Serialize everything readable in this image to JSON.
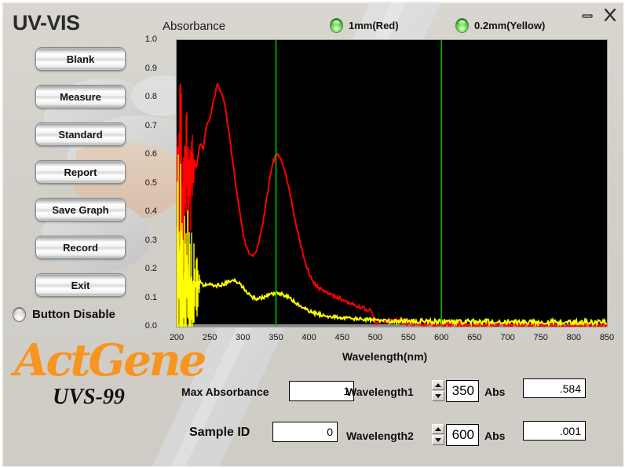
{
  "window": {
    "title": "UV-VIS",
    "minimize_icon": "minimize-icon",
    "close_icon": "close-icon"
  },
  "chart_header": {
    "title": "Absorbance",
    "legend": [
      {
        "label": "1mm(Red)",
        "led": "green-led",
        "color": "#ff0000"
      },
      {
        "label": "0.2mm(Yellow)",
        "led": "green-led",
        "color": "#ffff00"
      }
    ]
  },
  "sidebar": {
    "buttons": [
      {
        "label": "Blank"
      },
      {
        "label": "Measure"
      },
      {
        "label": "Standard"
      },
      {
        "label": "Report"
      },
      {
        "label": "Save Graph"
      },
      {
        "label": "Record"
      },
      {
        "label": "Exit"
      }
    ],
    "button_disable": {
      "label": "Button Disable",
      "led": "gray-led",
      "state": "off"
    }
  },
  "brand": {
    "name": "ActGene",
    "model": "UVS-99",
    "color": "#f79520"
  },
  "controls": {
    "max_absorbance": {
      "label": "Max Absorbance",
      "value": "1"
    },
    "sample_id": {
      "label": "Sample ID",
      "value": "0"
    },
    "wavelength1": {
      "label": "Wavelength1",
      "value": "350",
      "abs_label": "Abs",
      "abs_value": ".584"
    },
    "wavelength2": {
      "label": "Wavelength2",
      "value": "600",
      "abs_label": "Abs",
      "abs_value": ".001"
    }
  },
  "chart_data": {
    "type": "line",
    "title": "Absorbance",
    "xlabel": "Wavelength(nm)",
    "ylabel": "Absorbance",
    "xlim": [
      200,
      850
    ],
    "ylim": [
      0.0,
      1.0
    ],
    "xticks": [
      200,
      250,
      300,
      350,
      400,
      450,
      500,
      550,
      600,
      650,
      700,
      750,
      800,
      850
    ],
    "yticks": [
      0.0,
      0.1,
      0.2,
      0.3,
      0.4,
      0.5,
      0.6,
      0.7,
      0.8,
      0.9,
      1.0
    ],
    "grid": false,
    "legend_position": "top",
    "background": "#000000",
    "cursors": [
      {
        "name": "Wavelength1",
        "x": 350,
        "color": "#00c000"
      },
      {
        "name": "Wavelength2",
        "x": 600,
        "color": "#00c000"
      }
    ],
    "series": [
      {
        "name": "1mm(Red)",
        "color": "#ff0000",
        "noisy_below_nm": 228,
        "x": [
          200,
          205,
          210,
          215,
          220,
          225,
          230,
          235,
          240,
          245,
          250,
          255,
          260,
          262,
          265,
          270,
          275,
          280,
          285,
          290,
          295,
          300,
          305,
          310,
          315,
          320,
          325,
          330,
          335,
          340,
          345,
          350,
          355,
          360,
          365,
          370,
          375,
          380,
          385,
          390,
          395,
          400,
          405,
          410,
          415,
          420,
          425,
          430,
          435,
          440,
          445,
          450,
          455,
          460,
          465,
          470,
          475,
          480,
          485,
          490,
          495,
          500,
          510,
          520,
          530,
          540,
          550,
          560,
          570,
          580,
          590,
          600,
          620,
          640,
          660,
          680,
          700,
          720,
          740,
          760,
          780,
          800,
          820,
          840,
          850
        ],
        "y": [
          0.3,
          0.52,
          0.4,
          0.62,
          0.47,
          0.58,
          0.55,
          0.64,
          0.62,
          0.7,
          0.72,
          0.78,
          0.83,
          0.85,
          0.83,
          0.8,
          0.74,
          0.66,
          0.57,
          0.48,
          0.4,
          0.33,
          0.28,
          0.25,
          0.245,
          0.26,
          0.3,
          0.36,
          0.43,
          0.51,
          0.57,
          0.6,
          0.595,
          0.57,
          0.53,
          0.48,
          0.42,
          0.36,
          0.31,
          0.26,
          0.22,
          0.185,
          0.16,
          0.145,
          0.135,
          0.127,
          0.12,
          0.115,
          0.11,
          0.105,
          0.1,
          0.095,
          0.09,
          0.085,
          0.08,
          0.075,
          0.07,
          0.066,
          0.062,
          0.058,
          0.056,
          0.01,
          0.018,
          0.02,
          0.018,
          0.016,
          0.014,
          0.012,
          0.01,
          0.009,
          0.008,
          0.007,
          0.006,
          0.006,
          0.005,
          0.005,
          0.005,
          0.004,
          0.004,
          0.004,
          0.003,
          0.003,
          0.003,
          0.003,
          0.003
        ]
      },
      {
        "name": "0.2mm(Yellow)",
        "color": "#ffff00",
        "noisy_below_nm": 235,
        "x": [
          200,
          205,
          210,
          215,
          220,
          225,
          230,
          235,
          240,
          245,
          250,
          255,
          260,
          265,
          270,
          275,
          280,
          285,
          290,
          295,
          300,
          305,
          310,
          315,
          320,
          325,
          330,
          335,
          340,
          345,
          350,
          355,
          360,
          365,
          370,
          375,
          380,
          385,
          390,
          395,
          400,
          410,
          420,
          430,
          440,
          450,
          460,
          470,
          480,
          490,
          500,
          520,
          540,
          560,
          580,
          600,
          640,
          680,
          720,
          760,
          800,
          850
        ],
        "y": [
          0.12,
          0.17,
          0.1,
          0.16,
          0.13,
          0.15,
          0.14,
          0.155,
          0.145,
          0.15,
          0.147,
          0.145,
          0.143,
          0.145,
          0.148,
          0.152,
          0.157,
          0.16,
          0.158,
          0.15,
          0.138,
          0.124,
          0.112,
          0.103,
          0.098,
          0.098,
          0.101,
          0.105,
          0.11,
          0.114,
          0.116,
          0.115,
          0.112,
          0.107,
          0.1,
          0.092,
          0.083,
          0.075,
          0.067,
          0.06,
          0.054,
          0.046,
          0.04,
          0.036,
          0.033,
          0.031,
          0.029,
          0.027,
          0.026,
          0.024,
          0.023,
          0.021,
          0.02,
          0.019,
          0.019,
          0.018,
          0.017,
          0.017,
          0.016,
          0.016,
          0.016,
          0.015
        ]
      }
    ]
  }
}
